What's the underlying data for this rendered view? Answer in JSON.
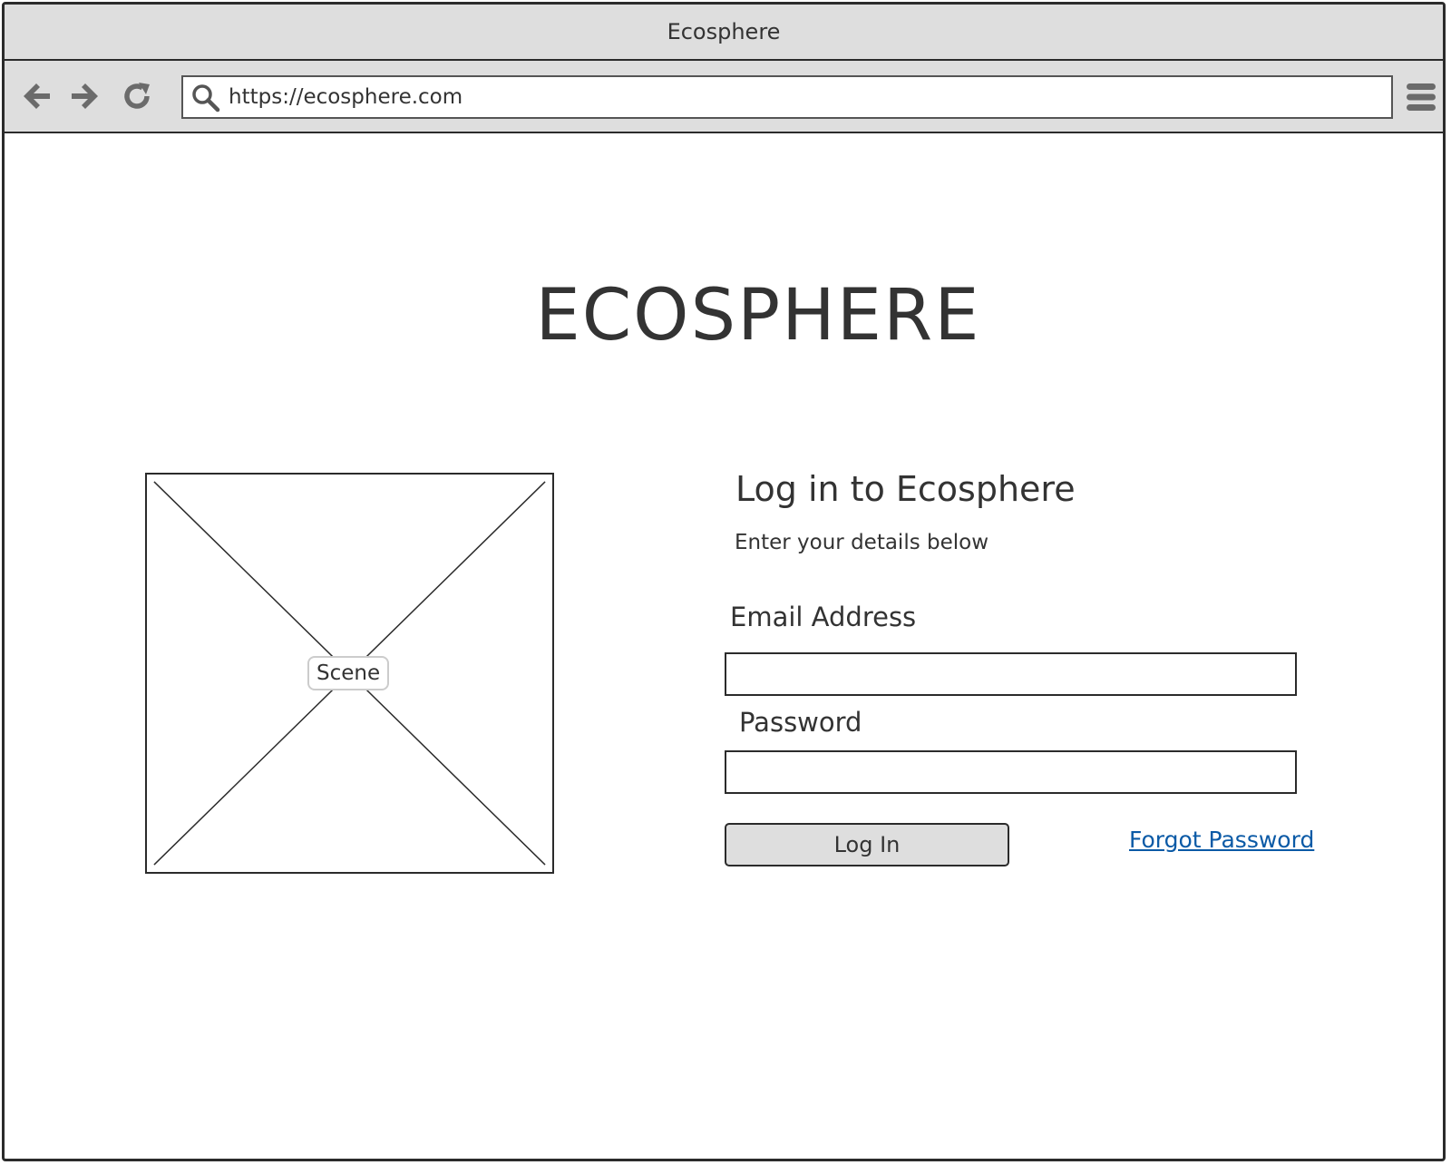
{
  "browser": {
    "window_title": "Ecosphere",
    "url": "https://ecosphere.com"
  },
  "page": {
    "brand": "ECOSPHERE",
    "image_placeholder_label": "Scene",
    "login": {
      "title": "Log in to Ecosphere",
      "subtitle": "Enter your details below",
      "email_label": "Email Address",
      "email_value": "",
      "password_label": "Password",
      "password_value": "",
      "submit_label": "Log In",
      "forgot_password_label": "Forgot Password"
    }
  },
  "colors": {
    "chrome_background": "#dedede",
    "border": "#2b2b2b",
    "text": "#333333",
    "link": "#0b5aa6"
  },
  "icons": {
    "back": "arrow-left-icon",
    "forward": "arrow-right-icon",
    "reload": "reload-icon",
    "search": "search-icon",
    "menu": "hamburger-menu-icon"
  }
}
